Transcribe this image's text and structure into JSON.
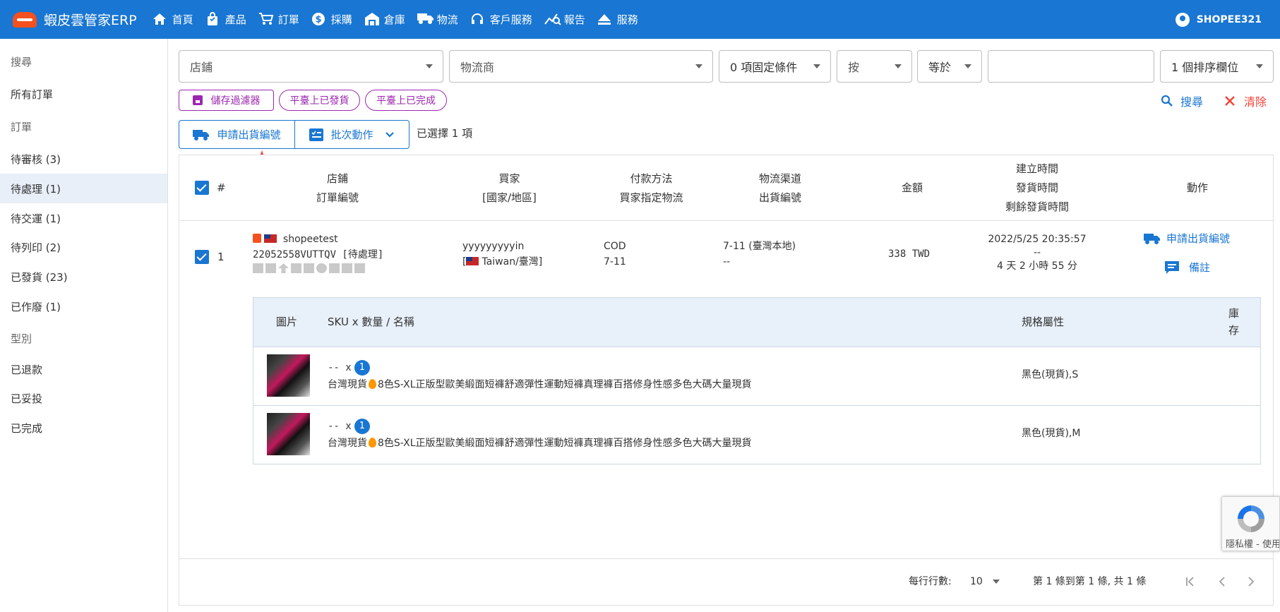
{
  "brand": {
    "title": "蝦皮雲管家ERP"
  },
  "nav": [
    {
      "label": "首頁",
      "icon": "home-icon"
    },
    {
      "label": "產品",
      "icon": "shopping-bag-icon"
    },
    {
      "label": "訂單",
      "icon": "cart-icon"
    },
    {
      "label": "採購",
      "icon": "dollar-icon"
    },
    {
      "label": "倉庫",
      "icon": "warehouse-icon"
    },
    {
      "label": "物流",
      "icon": "truck-icon"
    },
    {
      "label": "客戶服務",
      "icon": "headset-icon"
    },
    {
      "label": "報告",
      "icon": "chart-search-icon"
    },
    {
      "label": "服務",
      "icon": "eject-icon"
    }
  ],
  "user": {
    "name": "SHOPEE321"
  },
  "sidebar": [
    {
      "label": "搜尋",
      "type": "header"
    },
    {
      "label": "所有訂單",
      "type": "item"
    },
    {
      "label": "訂單",
      "type": "header"
    },
    {
      "label": "待審核 (3)",
      "type": "item"
    },
    {
      "label": "待處理 (1)",
      "type": "item",
      "active": true
    },
    {
      "label": "待交運 (1)",
      "type": "item"
    },
    {
      "label": "待列印 (2)",
      "type": "item"
    },
    {
      "label": "已發貨 (23)",
      "type": "item"
    },
    {
      "label": "已作廢 (1)",
      "type": "item"
    },
    {
      "label": "型別",
      "type": "header"
    },
    {
      "label": "已退款",
      "type": "item"
    },
    {
      "label": "已妥投",
      "type": "item"
    },
    {
      "label": "已完成",
      "type": "item"
    }
  ],
  "filters": {
    "shop": "店鋪",
    "logistics": "物流商",
    "fixed_conditions": "0 項固定條件",
    "by": "按",
    "operator": "等於",
    "value": "",
    "sort": "1 個排序欄位"
  },
  "chips": {
    "save_filter": "儲存過濾器",
    "shipped_on_platform": "平臺上已發貨",
    "completed_on_platform": "平臺上已完成"
  },
  "actions": {
    "search": "搜尋",
    "clear": "清除",
    "request_tracking": "申請出貨編號",
    "batch": "批次動作",
    "selected": "已選擇 1 項"
  },
  "table": {
    "headers": {
      "index": "#",
      "shop_1": "店鋪",
      "shop_2": "訂單編號",
      "buyer_1": "買家",
      "buyer_2": "[國家/地區]",
      "payment_1": "付款方法",
      "payment_2": "買家指定物流",
      "channel_1": "物流渠道",
      "channel_2": "出貨編號",
      "amount": "金額",
      "time_1": "建立時間",
      "time_2": "發貨時間",
      "time_3": "剩餘發貨時間",
      "action": "動作"
    },
    "row": {
      "index": "1",
      "shop": "shopeetest",
      "order_no": "22052558VUTTQV [待處理]",
      "buyer": "yyyyyyyyyin",
      "country": "Taiwan/臺灣",
      "payment": "COD",
      "designated": "7-11",
      "channel": "7-11 (臺灣本地)",
      "tracking": "--",
      "amount": "338 TWD",
      "created": "2022/5/25 20:35:57",
      "shipped": "--",
      "remaining": "4 天 2 小時 55 分",
      "action_request": "申請出貨編號",
      "action_note": "備註"
    },
    "sub_headers": {
      "image": "圖片",
      "sku": "SKU x 數量 / 名稱",
      "spec": "規格屬性",
      "stock_1": "庫",
      "stock_2": "存"
    },
    "items": [
      {
        "sku": "-- x",
        "qty": "1",
        "name_a": "台灣現貨",
        "name_b": "8色S-XL正版型歐美緞面短褲舒適彈性運動短褲真理褲百搭修身性感多色大碼大量現貨",
        "spec": "黑色(現貨),S"
      },
      {
        "sku": "-- x",
        "qty": "1",
        "name_a": "台灣現貨",
        "name_b": "8色S-XL正版型歐美緞面短褲舒適彈性運動短褲真理褲百搭修身性感多色大碼大量現貨",
        "spec": "黑色(現貨),M"
      }
    ]
  },
  "pagination": {
    "rows_label": "每行行數:",
    "rows_value": "10",
    "range": "第 1 條到第 1 條, 共 1 條"
  },
  "recaptcha": {
    "text": "隱私權 - 使用條款"
  },
  "colors": {
    "primary": "#1976d2",
    "accent": "#9c27b0",
    "danger": "#f44336"
  }
}
